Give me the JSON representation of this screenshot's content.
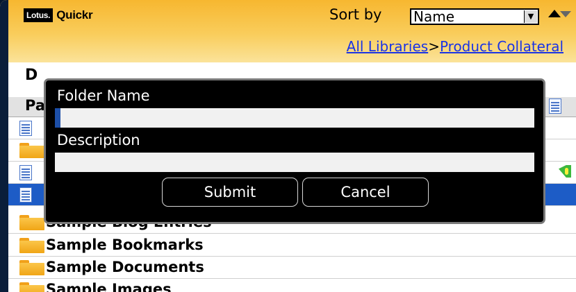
{
  "header": {
    "logo_mark": "Lotus.",
    "logo_text": "Quickr",
    "sort_label": "Sort by",
    "sort_value": "Name",
    "sort_dropdown_icon": "chevron-down-icon",
    "sort_asc_icon": "triangle-up-icon",
    "sort_desc_icon": "triangle-down-icon"
  },
  "breadcrumb": {
    "root": "All Libraries",
    "separator": ">",
    "current": "Product Collateral"
  },
  "page_title_partial": "D",
  "column_header_partial": "Pa",
  "rows": [
    {
      "icon": "document-icon",
      "label": "",
      "selected": false
    },
    {
      "icon": "folder-icon",
      "label": "",
      "selected": false
    },
    {
      "icon": "document-icon",
      "label": "",
      "selected": false
    },
    {
      "icon": "document-icon",
      "label": "",
      "selected": true
    },
    {
      "icon": "folder-icon",
      "label": "Sample Blog Entries",
      "selected": false
    },
    {
      "icon": "folder-icon",
      "label": "Sample Bookmarks",
      "selected": false
    },
    {
      "icon": "folder-icon",
      "label": "Sample Documents",
      "selected": false
    },
    {
      "icon": "folder-icon",
      "label": "Sample Images",
      "selected": false
    }
  ],
  "dialog": {
    "folder_name_label": "Folder Name",
    "folder_name_value": "",
    "description_label": "Description",
    "description_value": "",
    "submit_label": "Submit",
    "cancel_label": "Cancel"
  },
  "colors": {
    "header_gradient_top": "#f7b730",
    "header_gradient_bottom": "#fbe39a",
    "link": "#1a33e6",
    "selection": "#1d5cc6",
    "dialog_bg": "#000000"
  }
}
